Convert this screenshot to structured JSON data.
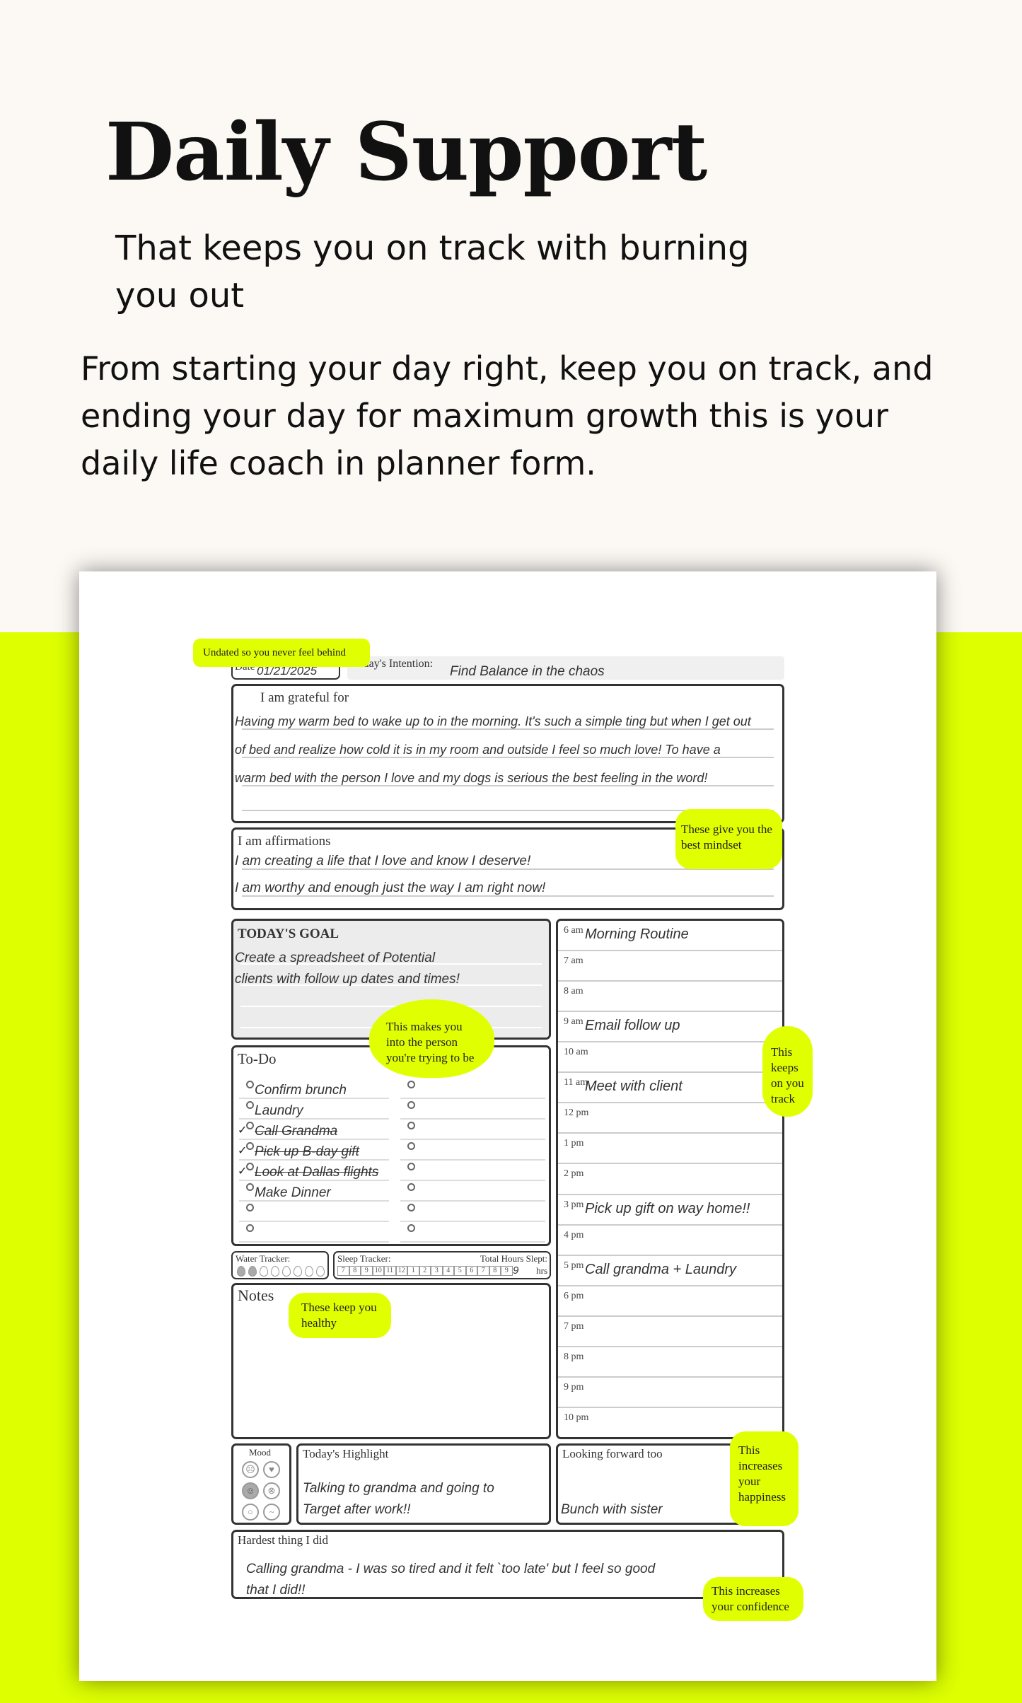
{
  "hero": {
    "title": "Daily Support",
    "subtitle": "That keeps you on track with burning you out",
    "description": "From starting your day right, keep you on track, and ending your day for maximum growth this is your daily life coach in planner form."
  },
  "colors": {
    "accent": "#ddff00",
    "cream": "#fcf8f4"
  },
  "planner": {
    "date_label": "Date",
    "date_value": "01/21/2025",
    "intention_label": "Today's Intention:",
    "intention_value": "Find Balance in the chaos",
    "grateful_label": "I am grateful for",
    "grateful_lines": [
      "Having my warm bed to wake up to in the morning. It's such a simple ting but when I get out",
      "of bed and realize how cold it is in my room and outside I feel so much love! To have a",
      "warm bed with the person I love and my dogs is serious the best feeling in the word!"
    ],
    "affirm_label": "I am affirmations",
    "affirm_lines": [
      "I am creating a life that I love and know I deserve!",
      "I am worthy and enough just the way I am right now!"
    ],
    "goal_label": "TODAY'S GOAL",
    "goal_lines": [
      "Create a spreadsheet of Potential",
      "clients with follow up dates and times!"
    ],
    "todo_label": "To-Do",
    "todo_items": [
      {
        "text": "Confirm brunch",
        "done": false
      },
      {
        "text": "Laundry",
        "done": false
      },
      {
        "text": "Call Grandma",
        "done": true
      },
      {
        "text": "Pick up B-day gift",
        "done": true
      },
      {
        "text": "Look at Dallas flights",
        "done": true
      },
      {
        "text": "Make Dinner",
        "done": false
      },
      {
        "text": "",
        "done": false
      },
      {
        "text": "",
        "done": false
      }
    ],
    "schedule": [
      {
        "time": "6 am",
        "entry": "Morning Routine"
      },
      {
        "time": "7 am",
        "entry": ""
      },
      {
        "time": "8 am",
        "entry": ""
      },
      {
        "time": "9 am",
        "entry": "Email follow up"
      },
      {
        "time": "10 am",
        "entry": ""
      },
      {
        "time": "11 am",
        "entry": "Meet with client"
      },
      {
        "time": "12 pm",
        "entry": ""
      },
      {
        "time": "1 pm",
        "entry": ""
      },
      {
        "time": "2 pm",
        "entry": ""
      },
      {
        "time": "3 pm",
        "entry": "Pick up gift on way home!!"
      },
      {
        "time": "4 pm",
        "entry": ""
      },
      {
        "time": "5 pm",
        "entry": "Call grandma + Laundry"
      },
      {
        "time": "6 pm",
        "entry": ""
      },
      {
        "time": "7 pm",
        "entry": ""
      },
      {
        "time": "8 pm",
        "entry": ""
      },
      {
        "time": "9 pm",
        "entry": ""
      },
      {
        "time": "10 pm",
        "entry": ""
      }
    ],
    "water_label": "Water Tracker:",
    "water_drops": 8,
    "water_filled": 2,
    "sleep_label": "Sleep Tracker:",
    "sleep_total_label": "Total Hours Slept:",
    "sleep_hours": [
      "7",
      "8",
      "9",
      "10",
      "11",
      "12",
      "1",
      "2",
      "3",
      "4",
      "5",
      "6",
      "7",
      "8",
      "9"
    ],
    "sleep_value": "9",
    "sleep_unit": "hrs",
    "notes_label": "Notes",
    "mood_label": "Mood",
    "mood_selected": "happy",
    "highlight_label": "Today's Highlight",
    "highlight_lines": [
      "Talking to grandma and going to",
      "Target after work!!"
    ],
    "forward_label": "Looking forward too",
    "forward_value": "Bunch with sister",
    "hardest_label": "Hardest thing I did",
    "hardest_lines": [
      "Calling grandma - I was so tired and it felt `too late' but I feel so good",
      "that I did!!"
    ]
  },
  "callouts": {
    "undated": "Undated so you never feel behind",
    "mindset": "These give you the best mindset",
    "person": "This makes you into the person you're trying to be",
    "track": "This keeps on you track",
    "healthy": "These keep you healthy",
    "happiness": "This increases your happiness",
    "confidence": "This increases your confidence"
  }
}
